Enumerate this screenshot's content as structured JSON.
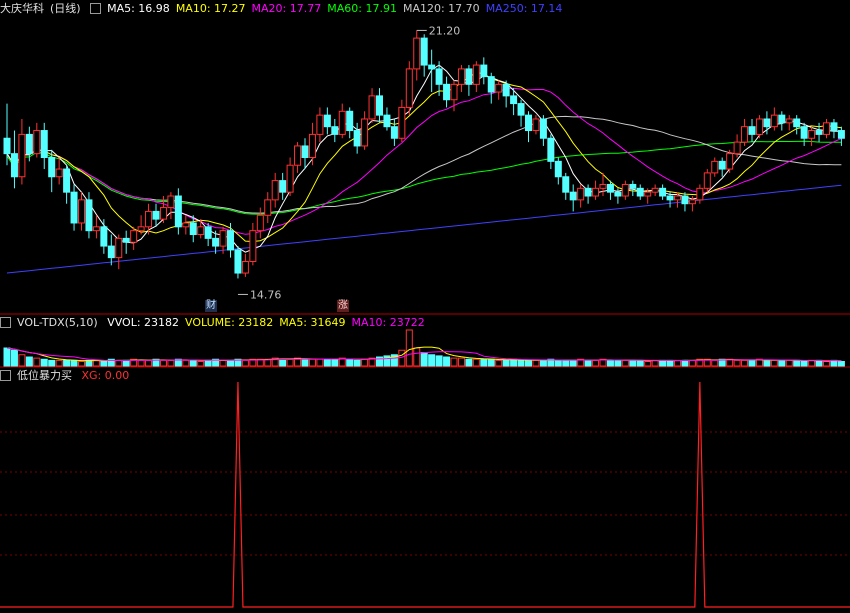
{
  "main_panel": {
    "stock_name": "大庆华科",
    "period": "(日线)",
    "ma_labels": [
      {
        "text": "MA5: 16.98",
        "color": "#ffffff"
      },
      {
        "text": "MA10: 17.27",
        "color": "#ffff00"
      },
      {
        "text": "MA20: 17.77",
        "color": "#ff00ff"
      },
      {
        "text": "MA60: 17.91",
        "color": "#00ff00"
      },
      {
        "text": "MA120: 17.70",
        "color": "#c8c8c8"
      },
      {
        "text": "MA250: 17.14",
        "color": "#4040ff"
      }
    ],
    "high_label": "21.20",
    "low_label": "14.76",
    "tag_cai": "财",
    "tag_zhang": "涨"
  },
  "volume_panel": {
    "indicator": "VOL-TDX(5,10)",
    "labels": [
      {
        "text": "VVOL: 23182",
        "color": "#ffffff"
      },
      {
        "text": "VOLUME: 23182",
        "color": "#ffff00"
      },
      {
        "text": "MA5: 31649",
        "color": "#ffff00"
      },
      {
        "text": "MA10: 23722",
        "color": "#ff00ff"
      }
    ]
  },
  "signal_panel": {
    "indicator": "低位暴力买",
    "xg_label": "XG: 0.00"
  },
  "colors": {
    "up": "#ff3232",
    "down": "#54ffff",
    "ma5": "#ffffff",
    "ma10": "#ffff00",
    "ma20": "#ff00ff",
    "ma60": "#00ff00",
    "ma120": "#c8c8c8",
    "ma250": "#4040ff",
    "signal": "#ff2020",
    "grid": "#7a0000",
    "divider": "#b00000"
  },
  "chart_data": {
    "type": "candlestick",
    "price_range": [
      14.2,
      21.6
    ],
    "candles": [
      [
        18.4,
        18.0,
        19.3,
        17.7
      ],
      [
        18.0,
        17.4,
        18.6,
        17.1
      ],
      [
        17.4,
        18.5,
        18.9,
        17.2
      ],
      [
        18.5,
        18.0,
        18.7,
        17.8
      ],
      [
        18.0,
        18.6,
        18.8,
        17.9
      ],
      [
        18.6,
        17.9,
        18.8,
        17.6
      ],
      [
        17.9,
        17.4,
        18.1,
        17.0
      ],
      [
        17.4,
        17.6,
        17.9,
        17.2
      ],
      [
        17.6,
        17.0,
        17.7,
        16.7
      ],
      [
        17.0,
        16.2,
        17.2,
        16.0
      ],
      [
        16.2,
        16.8,
        17.0,
        16.0
      ],
      [
        16.8,
        16.0,
        17.0,
        15.8
      ],
      [
        16.0,
        16.1,
        16.4,
        15.8
      ],
      [
        16.1,
        15.6,
        16.3,
        15.4
      ],
      [
        15.6,
        15.3,
        15.9,
        15.1
      ],
      [
        15.3,
        15.8,
        15.9,
        15.0
      ],
      [
        15.8,
        15.7,
        16.0,
        15.4
      ],
      [
        15.7,
        16.0,
        16.1,
        15.5
      ],
      [
        16.0,
        16.1,
        16.4,
        15.9
      ],
      [
        16.1,
        16.5,
        16.7,
        15.9
      ],
      [
        16.5,
        16.3,
        16.7,
        16.1
      ],
      [
        16.3,
        16.6,
        16.9,
        16.2
      ],
      [
        16.6,
        16.9,
        17.0,
        16.3
      ],
      [
        16.9,
        16.1,
        17.1,
        15.9
      ],
      [
        16.1,
        16.2,
        16.4,
        15.9
      ],
      [
        16.2,
        15.9,
        16.4,
        15.7
      ],
      [
        15.9,
        16.1,
        16.3,
        15.8
      ],
      [
        16.1,
        15.8,
        16.2,
        15.6
      ],
      [
        15.8,
        15.6,
        16.0,
        15.4
      ],
      [
        15.6,
        16.0,
        16.1,
        15.4
      ],
      [
        16.0,
        15.5,
        16.2,
        15.3
      ],
      [
        15.5,
        14.9,
        15.6,
        14.76
      ],
      [
        14.9,
        15.2,
        15.4,
        14.8
      ],
      [
        15.2,
        16.0,
        16.2,
        15.1
      ],
      [
        16.0,
        16.4,
        16.6,
        15.8
      ],
      [
        16.4,
        16.8,
        17.0,
        16.2
      ],
      [
        16.8,
        17.3,
        17.5,
        16.6
      ],
      [
        17.3,
        17.0,
        17.5,
        16.8
      ],
      [
        17.0,
        17.7,
        17.9,
        16.9
      ],
      [
        17.7,
        18.2,
        18.3,
        17.5
      ],
      [
        18.2,
        17.9,
        18.4,
        17.6
      ],
      [
        17.9,
        18.5,
        18.8,
        17.7
      ],
      [
        18.5,
        19.0,
        19.2,
        18.3
      ],
      [
        19.0,
        18.7,
        19.2,
        18.5
      ],
      [
        18.7,
        18.5,
        18.9,
        18.3
      ],
      [
        18.5,
        19.1,
        19.3,
        18.4
      ],
      [
        19.1,
        18.6,
        19.2,
        18.4
      ],
      [
        18.6,
        18.2,
        18.8,
        18.0
      ],
      [
        18.2,
        18.9,
        19.1,
        18.1
      ],
      [
        18.9,
        19.5,
        19.7,
        18.8
      ],
      [
        19.5,
        19.0,
        19.7,
        18.8
      ],
      [
        19.0,
        18.7,
        19.2,
        18.6
      ],
      [
        18.7,
        18.4,
        18.9,
        18.2
      ],
      [
        18.4,
        19.2,
        19.4,
        18.3
      ],
      [
        19.2,
        20.2,
        20.4,
        19.0
      ],
      [
        20.2,
        21.0,
        21.2,
        19.9
      ],
      [
        21.0,
        20.3,
        21.1,
        20.0
      ],
      [
        20.3,
        20.2,
        20.7,
        19.6
      ],
      [
        20.2,
        19.8,
        20.4,
        19.5
      ],
      [
        19.8,
        19.4,
        20.0,
        19.2
      ],
      [
        19.4,
        19.8,
        19.9,
        19.1
      ],
      [
        19.8,
        20.2,
        20.3,
        19.6
      ],
      [
        20.2,
        19.8,
        20.3,
        19.5
      ],
      [
        19.8,
        20.3,
        20.4,
        19.6
      ],
      [
        20.3,
        20.0,
        20.5,
        19.8
      ],
      [
        20.0,
        19.6,
        20.1,
        19.3
      ],
      [
        19.6,
        19.8,
        19.9,
        19.4
      ],
      [
        19.8,
        19.5,
        19.9,
        19.2
      ],
      [
        19.5,
        19.3,
        19.7,
        19.0
      ],
      [
        19.3,
        19.0,
        19.4,
        18.7
      ],
      [
        19.0,
        18.6,
        19.1,
        18.3
      ],
      [
        18.6,
        18.9,
        19.0,
        18.5
      ],
      [
        18.9,
        18.4,
        19.0,
        18.2
      ],
      [
        18.4,
        17.8,
        18.5,
        17.6
      ],
      [
        17.8,
        17.4,
        17.9,
        17.2
      ],
      [
        17.4,
        17.0,
        17.5,
        16.8
      ],
      [
        17.0,
        16.8,
        17.2,
        16.5
      ],
      [
        16.8,
        17.1,
        17.2,
        16.6
      ],
      [
        17.1,
        16.9,
        17.2,
        16.7
      ],
      [
        16.9,
        17.1,
        17.3,
        16.8
      ],
      [
        17.1,
        17.2,
        17.5,
        16.9
      ],
      [
        17.2,
        17.0,
        17.3,
        16.8
      ],
      [
        17.0,
        16.9,
        17.1,
        16.7
      ],
      [
        16.9,
        17.2,
        17.3,
        16.8
      ],
      [
        17.2,
        17.1,
        17.3,
        16.9
      ],
      [
        17.1,
        16.9,
        17.2,
        16.8
      ],
      [
        16.9,
        17.0,
        17.1,
        16.7
      ],
      [
        17.0,
        17.1,
        17.2,
        16.9
      ],
      [
        17.1,
        16.9,
        17.2,
        16.8
      ],
      [
        16.9,
        16.8,
        17.0,
        16.6
      ],
      [
        16.8,
        16.9,
        17.0,
        16.6
      ],
      [
        16.9,
        16.7,
        17.0,
        16.5
      ],
      [
        16.7,
        16.8,
        16.9,
        16.5
      ],
      [
        16.8,
        17.1,
        17.2,
        16.7
      ],
      [
        17.1,
        17.5,
        17.6,
        17.0
      ],
      [
        17.5,
        17.8,
        17.9,
        17.4
      ],
      [
        17.8,
        17.6,
        17.9,
        17.4
      ],
      [
        17.6,
        18.0,
        18.1,
        17.5
      ],
      [
        18.0,
        18.3,
        18.5,
        17.9
      ],
      [
        18.3,
        18.7,
        18.9,
        18.2
      ],
      [
        18.7,
        18.5,
        18.9,
        18.3
      ],
      [
        18.5,
        18.9,
        19.0,
        18.4
      ],
      [
        18.9,
        18.7,
        19.1,
        18.5
      ],
      [
        18.7,
        19.0,
        19.2,
        18.6
      ],
      [
        19.0,
        18.8,
        19.1,
        18.6
      ],
      [
        18.8,
        18.9,
        19.0,
        18.6
      ],
      [
        18.9,
        18.7,
        19.0,
        18.5
      ],
      [
        18.7,
        18.4,
        18.8,
        18.2
      ],
      [
        18.4,
        18.6,
        18.7,
        18.2
      ],
      [
        18.6,
        18.5,
        18.8,
        18.3
      ],
      [
        18.5,
        18.8,
        18.9,
        18.4
      ],
      [
        18.8,
        18.6,
        18.9,
        18.4
      ],
      [
        18.6,
        18.4,
        18.7,
        18.2
      ]
    ],
    "volume": [
      1.6,
      1.4,
      1.0,
      0.8,
      0.7,
      0.6,
      0.5,
      0.5,
      0.5,
      0.5,
      0.4,
      0.5,
      0.5,
      0.4,
      0.6,
      0.5,
      0.5,
      0.6,
      0.5,
      0.5,
      0.6,
      0.5,
      0.5,
      0.6,
      0.5,
      0.5,
      0.4,
      0.5,
      0.6,
      0.5,
      0.5,
      0.6,
      0.5,
      0.6,
      0.6,
      0.6,
      0.7,
      0.6,
      0.6,
      0.7,
      0.6,
      0.6,
      0.6,
      0.6,
      0.6,
      0.7,
      0.6,
      0.5,
      0.6,
      0.7,
      0.8,
      0.9,
      1.0,
      1.4,
      3.2,
      1.6,
      1.2,
      1.0,
      0.9,
      0.8,
      0.7,
      0.7,
      0.6,
      0.6,
      0.6,
      0.6,
      0.5,
      0.5,
      0.6,
      0.5,
      0.5,
      0.5,
      0.5,
      0.6,
      0.5,
      0.5,
      0.5,
      0.6,
      0.5,
      0.5,
      0.6,
      0.5,
      0.5,
      0.5,
      0.5,
      0.5,
      0.4,
      0.5,
      0.5,
      0.5,
      0.5,
      0.5,
      0.5,
      0.6,
      0.6,
      0.5,
      0.6,
      0.6,
      0.5,
      0.5,
      0.5,
      0.6,
      0.5,
      0.5,
      0.5,
      0.5,
      0.5,
      0.4,
      0.5,
      0.5,
      0.4,
      0.5,
      0.4
    ],
    "signal_spikes": [
      31,
      93
    ],
    "signal_range": [
      0,
      1
    ]
  }
}
